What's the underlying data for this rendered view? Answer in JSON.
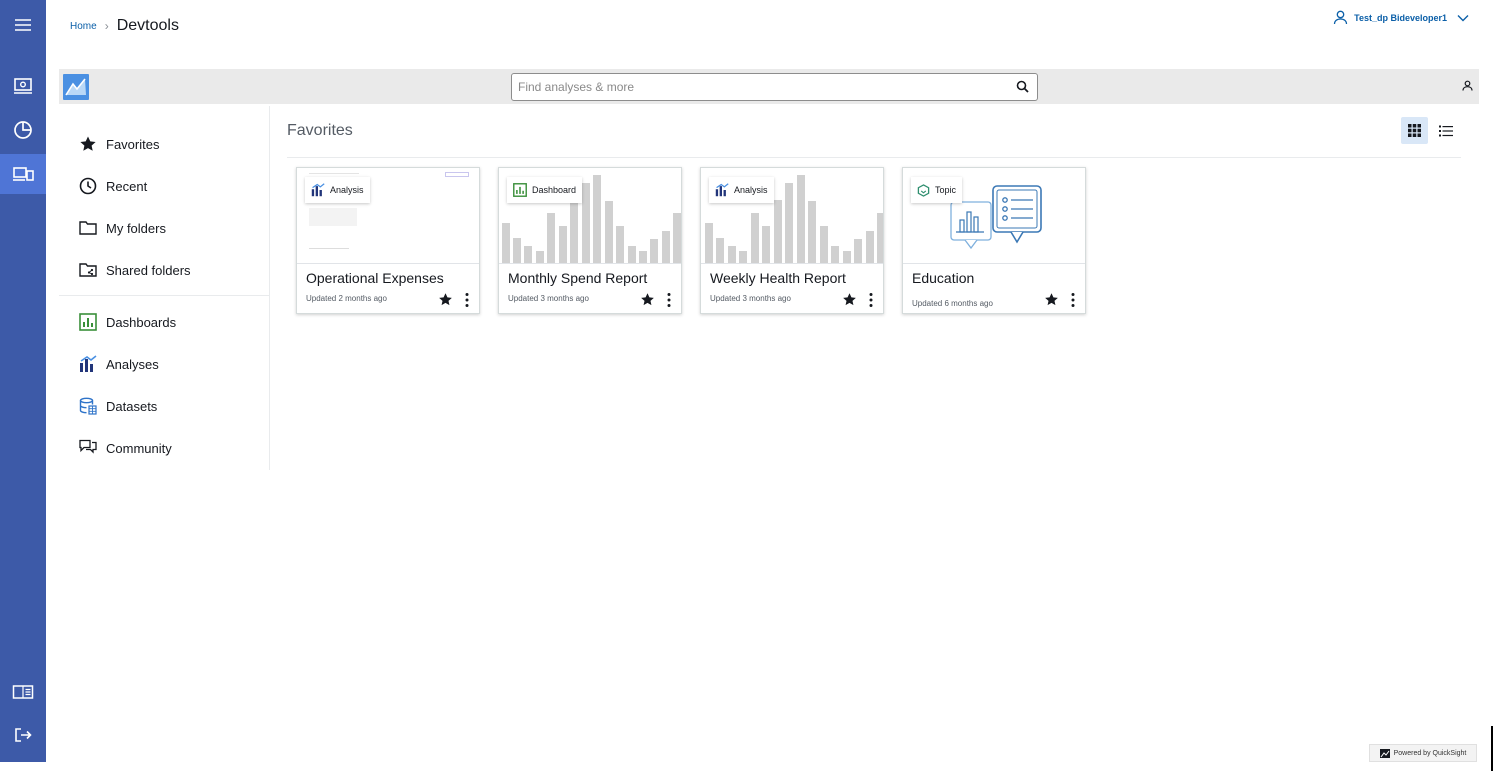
{
  "breadcrumb": {
    "home": "Home",
    "current": "Devtools"
  },
  "user": {
    "name": "Test_dp Bideveloper1"
  },
  "search": {
    "placeholder": "Find analyses & more"
  },
  "nav": {
    "favorites": "Favorites",
    "recent": "Recent",
    "my_folders": "My folders",
    "shared_folders": "Shared folders",
    "dashboards": "Dashboards",
    "analyses": "Analyses",
    "datasets": "Datasets",
    "community": "Community"
  },
  "main": {
    "title": "Favorites"
  },
  "cards": [
    {
      "type": "Analysis",
      "title": "Operational Expenses",
      "updated": "Updated 2 months ago"
    },
    {
      "type": "Dashboard",
      "title": "Monthly Spend Report",
      "updated": "Updated 3 months ago"
    },
    {
      "type": "Analysis",
      "title": "Weekly Health Report",
      "updated": "Updated 3 months ago"
    },
    {
      "type": "Topic",
      "title": "Education",
      "updated": "Updated 6 months ago"
    }
  ],
  "footer": {
    "powered": "Powered by QuickSight"
  },
  "colors": {
    "rail": "#3d5aa8",
    "rail_active": "#4f75d6",
    "link": "#0b5fa8",
    "accent": "#4a90e2"
  },
  "icons": [
    "menu-icon",
    "monitor-icon",
    "pie-chart-icon",
    "devices-icon",
    "book-icon",
    "sign-out-icon",
    "user-icon",
    "search-icon",
    "star-icon",
    "clock-icon",
    "folder-icon",
    "shared-folder-icon",
    "dashboard-icon",
    "analysis-icon",
    "dataset-icon",
    "community-icon",
    "grid-view-icon",
    "list-view-icon",
    "more-icon",
    "topic-icon"
  ]
}
